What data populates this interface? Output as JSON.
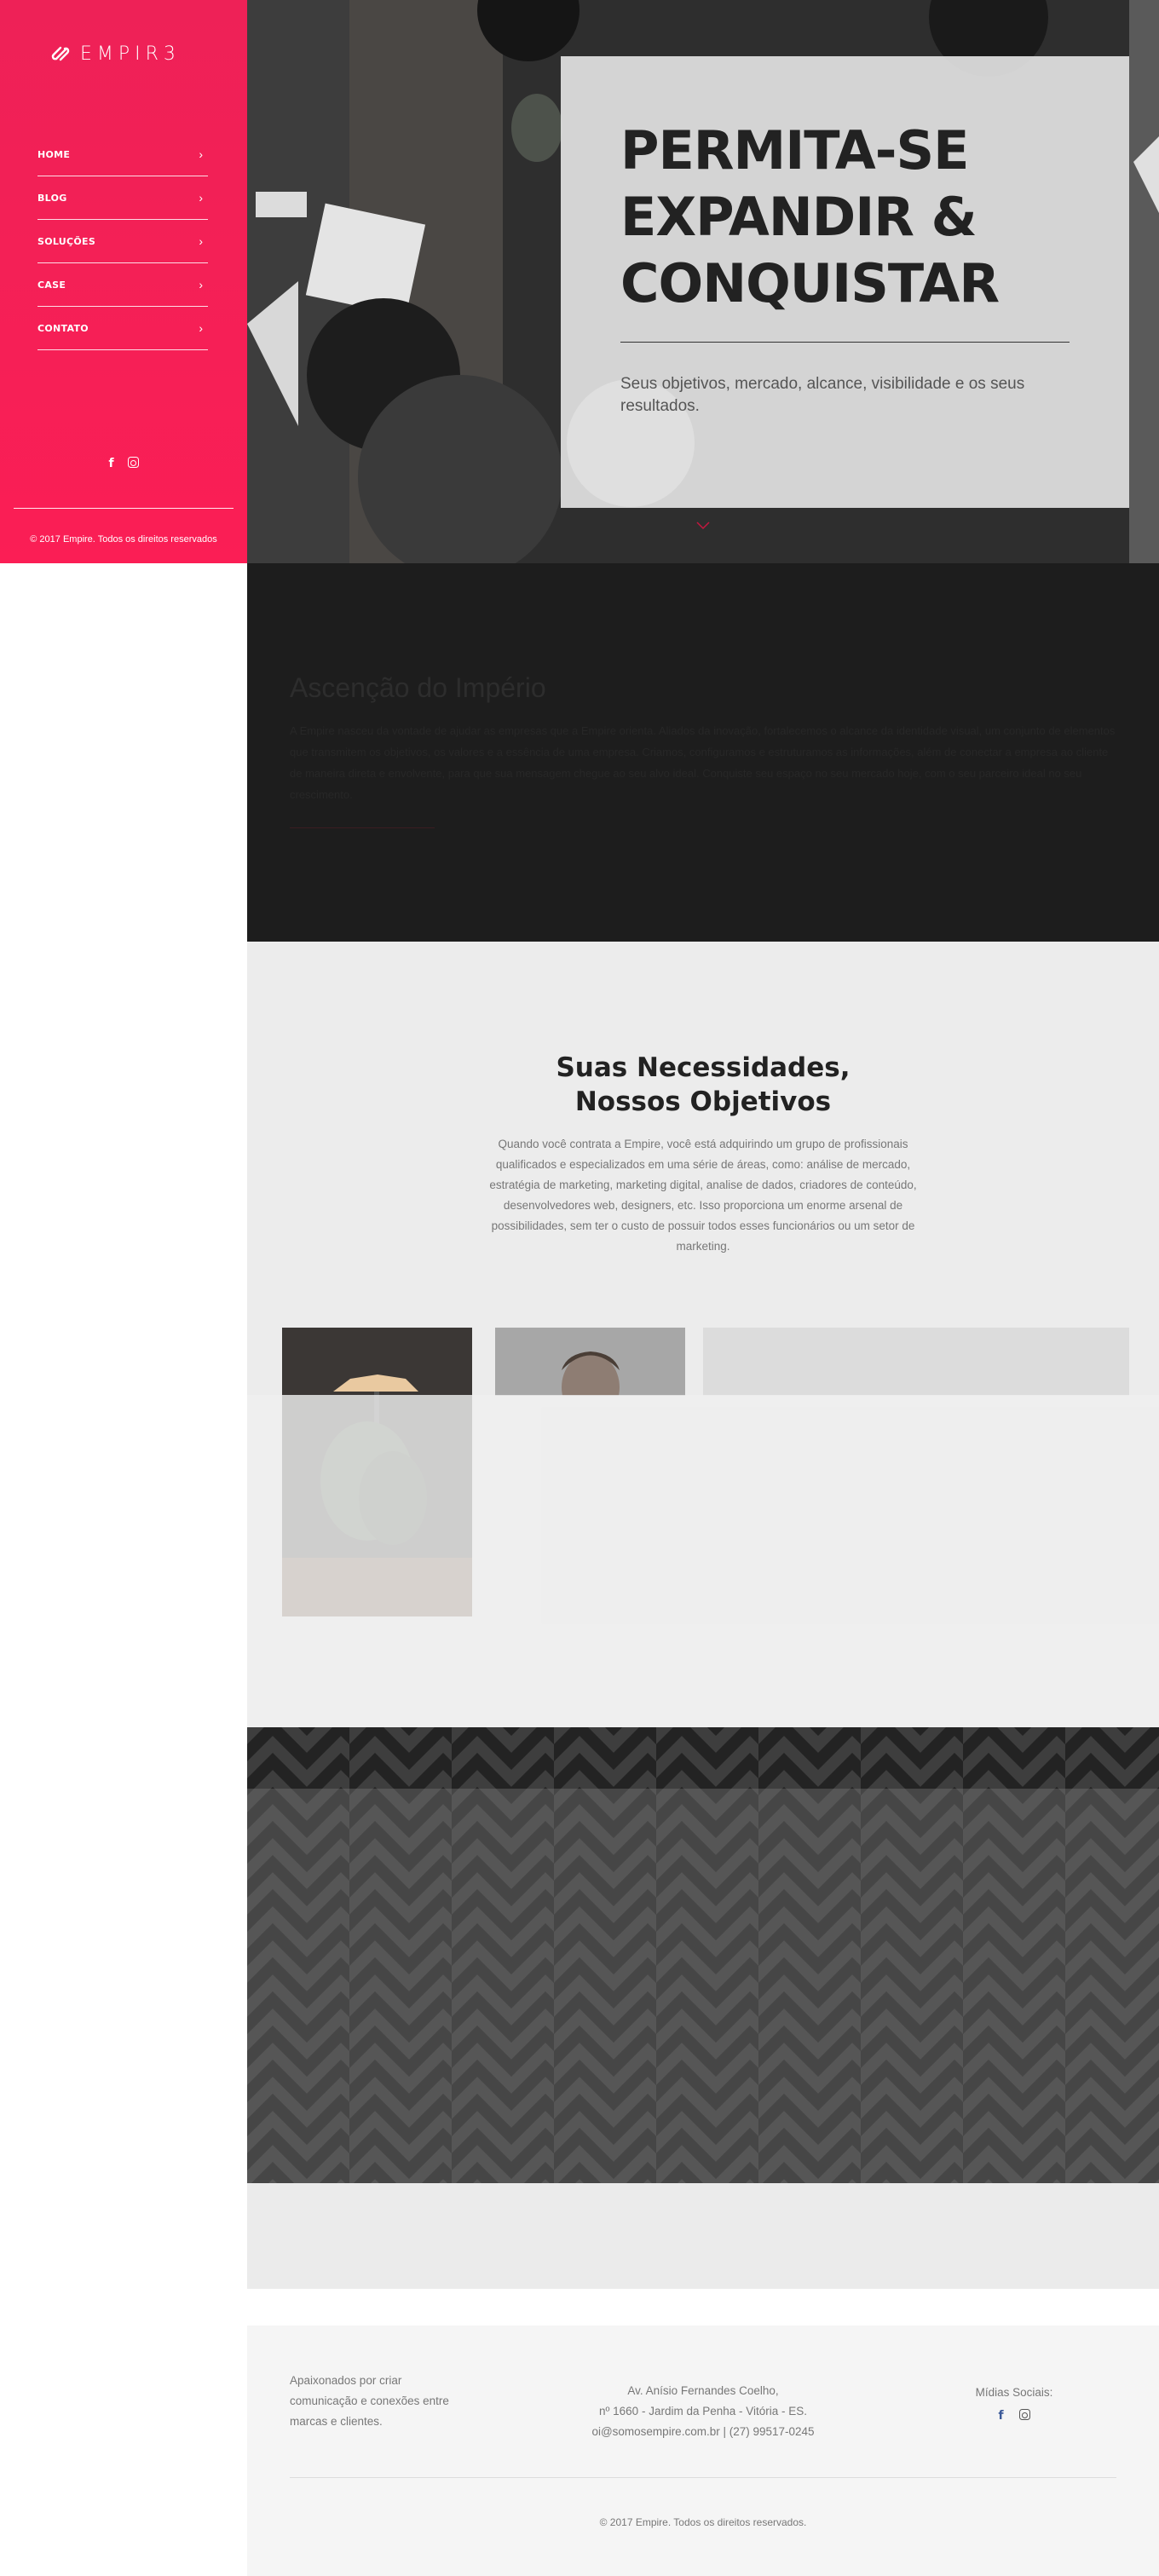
{
  "sidebar": {
    "logo_text": "EMPIR3",
    "nav": [
      {
        "label": "HOME"
      },
      {
        "label": "BLOG"
      },
      {
        "label": "SOLUÇÕES"
      },
      {
        "label": "CASE"
      },
      {
        "label": "CONTATO"
      }
    ],
    "nav_chevron": "›",
    "social_icons": [
      "facebook-icon",
      "instagram-icon"
    ],
    "copyright": "© 2017 Empire. Todos os direitos reservados"
  },
  "hero": {
    "title": "PERMITA-SE EXPANDIR & CONQUISTAR",
    "subtitle": "Seus objetivos, mercado, alcance, visibilidade e os seus resultados.",
    "scroll_icon": "chevron-down-icon"
  },
  "about": {
    "title": "Ascenção do Império",
    "text": "A Empire nasceu da vontade de ajudar as empresas que a Empire orienta. Aliados da inovação, fortalecemos o alcance da identidade visual, um conjunto de elementos que transmitem os objetivos, os valores e a essência de uma empresa. Criamos, configuramos e estruturamos as informações, além de conectar a empresa ao cliente de maneira direta e envolvente, para que sua mensagem chegue ao seu alvo ideal. Conquiste seu espaço no seu mercado hoje, com o seu parceiro ideal no seu crescimento."
  },
  "needs": {
    "title_line1": "Suas Necessidades,",
    "title_line2": "Nossos Objetivos",
    "text": "Quando você contrata a Empire, você está adquirindo um grupo de profissionais qualificados e especializados em uma série de áreas, como: análise de mercado, estratégia de marketing, marketing digital, analise de dados, criadores de conteúdo, desenvolvedores web, designers, etc. Isso proporciona um enorme arsenal de possibilidades, sem ter o custo de possuir todos esses funcionários ou um setor de marketing."
  },
  "footer": {
    "tagline": "Apaixonados por criar comunicação e conexões entre marcas e clientes.",
    "address_line1": "Av. Anísio Fernandes Coelho,",
    "address_line2": "nº 1660 - Jardim da Penha - Vitória - ES.",
    "contact": "oi@somosempire.com.br | (27) 99517-0245",
    "social_label": "Mídias Sociais:",
    "social_icons": [
      "facebook-icon",
      "instagram-icon"
    ],
    "copyright": "© 2017 Empire. Todos os direitos reservados."
  },
  "colors": {
    "brand": "#fb1e55",
    "dark": "#1d1d1d",
    "facebook_footer": "#3b5998"
  }
}
